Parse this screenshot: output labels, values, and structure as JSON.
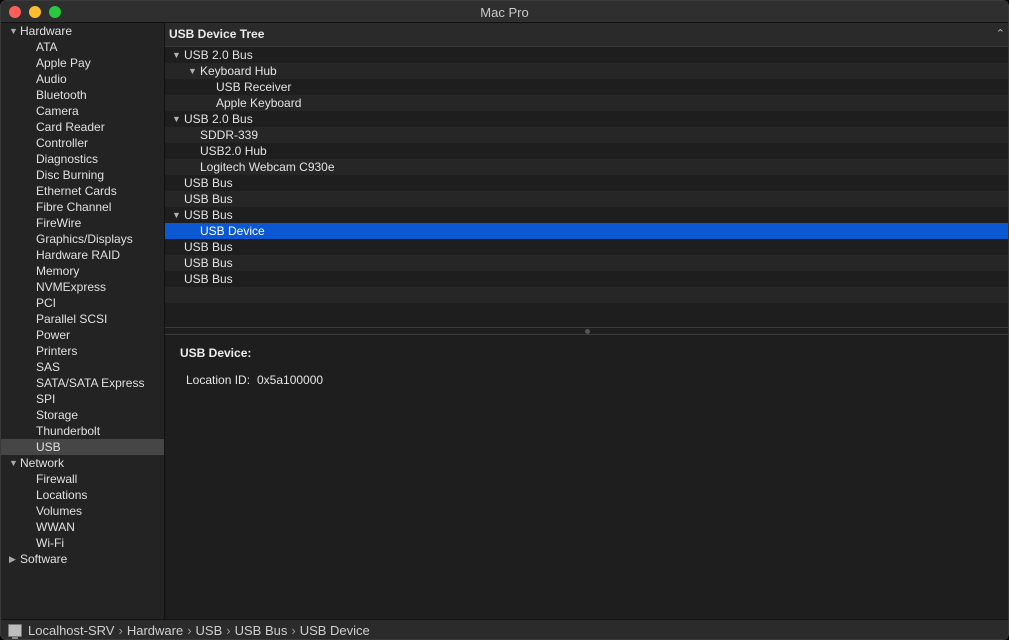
{
  "window": {
    "title": "Mac Pro"
  },
  "sidebar": {
    "groups": [
      {
        "label": "Hardware",
        "expanded": true,
        "items": [
          "ATA",
          "Apple Pay",
          "Audio",
          "Bluetooth",
          "Camera",
          "Card Reader",
          "Controller",
          "Diagnostics",
          "Disc Burning",
          "Ethernet Cards",
          "Fibre Channel",
          "FireWire",
          "Graphics/Displays",
          "Hardware RAID",
          "Memory",
          "NVMExpress",
          "PCI",
          "Parallel SCSI",
          "Power",
          "Printers",
          "SAS",
          "SATA/SATA Express",
          "SPI",
          "Storage",
          "Thunderbolt",
          "USB"
        ]
      },
      {
        "label": "Network",
        "expanded": true,
        "items": [
          "Firewall",
          "Locations",
          "Volumes",
          "WWAN",
          "Wi-Fi"
        ]
      },
      {
        "label": "Software",
        "expanded": false,
        "items": []
      }
    ],
    "selected": "USB"
  },
  "tree": {
    "header": "USB Device Tree",
    "rows": [
      {
        "label": "USB 2.0 Bus",
        "level": 0,
        "disclosure": "open"
      },
      {
        "label": "Keyboard Hub",
        "level": 1,
        "disclosure": "open"
      },
      {
        "label": "USB Receiver",
        "level": 2,
        "disclosure": "none"
      },
      {
        "label": "Apple Keyboard",
        "level": 2,
        "disclosure": "none"
      },
      {
        "label": "USB 2.0 Bus",
        "level": 0,
        "disclosure": "open"
      },
      {
        "label": "SDDR-339",
        "level": 1,
        "disclosure": "none"
      },
      {
        "label": "USB2.0 Hub",
        "level": 1,
        "disclosure": "none"
      },
      {
        "label": "Logitech Webcam C930e",
        "level": 1,
        "disclosure": "none"
      },
      {
        "label": "USB Bus",
        "level": 0,
        "disclosure": "none"
      },
      {
        "label": "USB Bus",
        "level": 0,
        "disclosure": "none"
      },
      {
        "label": "USB Bus",
        "level": 0,
        "disclosure": "open"
      },
      {
        "label": "USB Device",
        "level": 1,
        "disclosure": "none",
        "selected": true
      },
      {
        "label": "USB Bus",
        "level": 0,
        "disclosure": "none"
      },
      {
        "label": "USB Bus",
        "level": 0,
        "disclosure": "none"
      },
      {
        "label": "USB Bus",
        "level": 0,
        "disclosure": "none"
      }
    ]
  },
  "detail": {
    "title": "USB Device:",
    "fields": [
      {
        "key": "Location ID:",
        "value": "0x5a100000"
      }
    ]
  },
  "pathbar": {
    "items": [
      "Localhost-SRV",
      "Hardware",
      "USB",
      "USB Bus",
      "USB Device"
    ],
    "separator": "›"
  },
  "colors": {
    "selection": "#0b58d2",
    "sidebar_selection": "#464646"
  }
}
